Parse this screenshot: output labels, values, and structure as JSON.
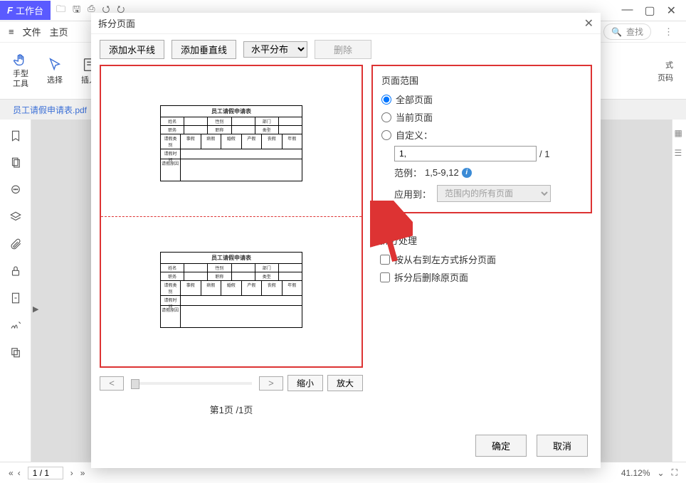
{
  "titlebar": {
    "workspace": "工作台"
  },
  "menubar": {
    "file": "文件",
    "home": "主页",
    "search_placeholder": "查找"
  },
  "toolbar": {
    "hand": "手型\n工具",
    "select": "选择",
    "insert": "插入",
    "right1": "式",
    "right2": "页码"
  },
  "doctab": {
    "name": "员工请假申请表.pdf"
  },
  "statusbar": {
    "page": "1 / 1",
    "zoom": "41.12%"
  },
  "dialog": {
    "title": "拆分页面",
    "toolbar": {
      "add_h": "添加水平线",
      "add_v": "添加垂直线",
      "distribute": "水平分布",
      "delete": "删除"
    },
    "preview": {
      "table_title": "员工请假申请表",
      "labels": {
        "name": "姓名",
        "gender": "性别",
        "dept": "部门",
        "position": "职务",
        "jobno": "职称",
        "type": "类型",
        "leave_type": "请假类别",
        "leave_time": "请假时间",
        "reason": "请假原因"
      },
      "checks": [
        "事假",
        "病假",
        "婚假",
        "产假",
        "丧假",
        "年假"
      ],
      "page_counter": "第1页 /1页",
      "zoom_out": "缩小",
      "zoom_in": "放大"
    },
    "range": {
      "group_title": "页面范围",
      "all": "全部页面",
      "current": "当前页面",
      "custom": "自定义：",
      "custom_value": "1,",
      "total": "/ 1",
      "example_label": "范例：",
      "example_value": "1,5-9,12",
      "apply_to": "应用到：",
      "apply_value": "范围内的所有页面"
    },
    "process": {
      "group_title": "拆分处理",
      "rtl": "按从右到左方式拆分页面",
      "del_orig": "拆分后删除原页面"
    },
    "footer": {
      "ok": "确定",
      "cancel": "取消"
    }
  }
}
